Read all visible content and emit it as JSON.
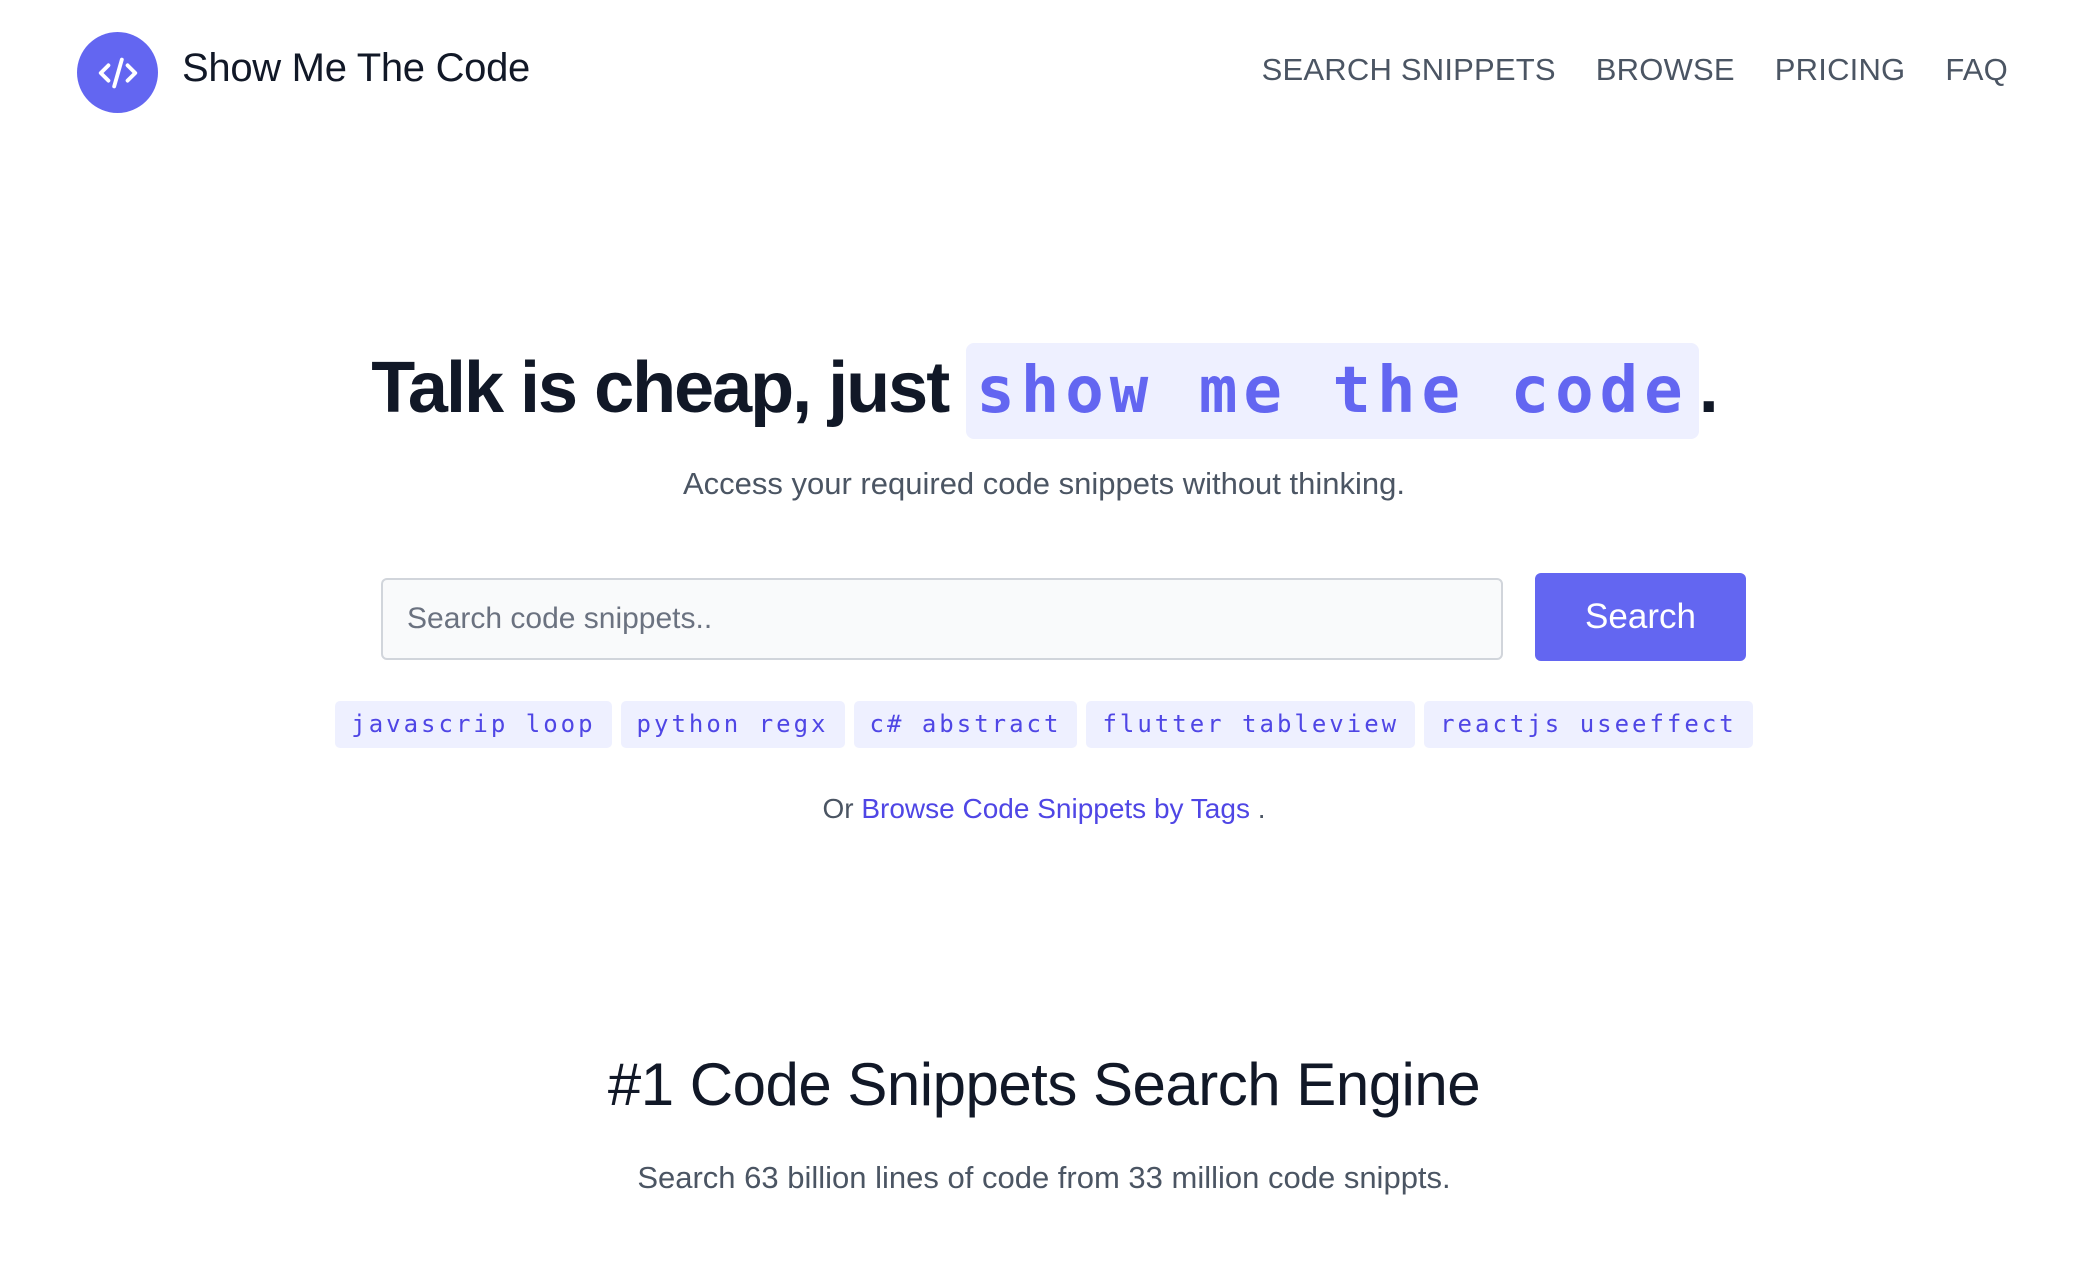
{
  "brand": {
    "name": "Show Me The Code",
    "icon": "code-brackets-icon",
    "color": "#6366f1"
  },
  "nav": {
    "items": [
      {
        "label": "SEARCH SNIPPETS"
      },
      {
        "label": "BROWSE"
      },
      {
        "label": "PRICING"
      },
      {
        "label": "FAQ"
      }
    ]
  },
  "hero": {
    "title_prefix": "Talk is cheap, just",
    "title_highlight": "show me the code",
    "title_suffix": ".",
    "subtitle": "Access your required code snippets without thinking."
  },
  "search": {
    "placeholder": "Search code snippets..",
    "value": "",
    "button_label": "Search"
  },
  "tags": [
    {
      "label": "javascrip loop"
    },
    {
      "label": "python regx"
    },
    {
      "label": "c# abstract"
    },
    {
      "label": "flutter tableview"
    },
    {
      "label": "reactjs useeffect"
    }
  ],
  "browse": {
    "prefix": "Or",
    "link_label": "Browse Code Snippets by Tags",
    "suffix": "."
  },
  "section": {
    "title": "#1 Code Snippets Search Engine",
    "subtitle": "Search 63 billion lines of code from 33 million code snippts."
  },
  "colors": {
    "accent": "#6366f1",
    "accent_light": "#eef0ff",
    "link": "#4f46e5"
  }
}
